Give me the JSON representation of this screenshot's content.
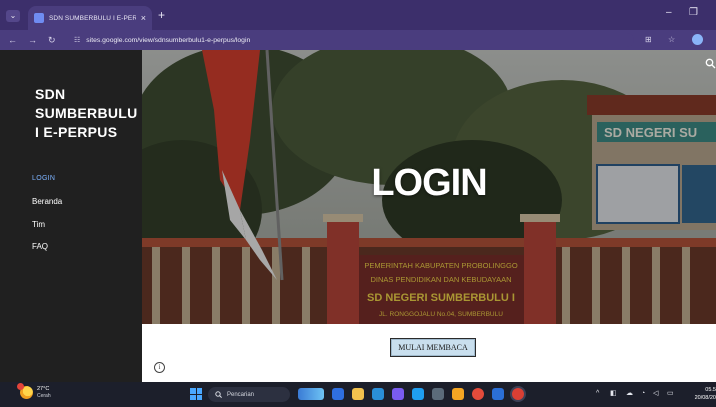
{
  "browser": {
    "tab_title": "SDN SUMBERBULU I E-PERPUS",
    "tab_close": "×",
    "new_tab": "+",
    "url": "sites.google.com/view/sdnsumberbulu1-e-perpus/login",
    "icons": [
      "tab-menu-icon",
      "back-icon",
      "forward-icon",
      "reload-icon",
      "site-settings-icon",
      "translate-icon",
      "bookmark-star-icon",
      "profile-icon",
      "minimize-icon",
      "restore-icon"
    ]
  },
  "sidebar": {
    "site_name": "SDN SUMBERBULU I E-PERPUS",
    "items": [
      {
        "label": "LOGIN",
        "active": true
      },
      {
        "label": "Beranda",
        "active": false
      },
      {
        "label": "Tim",
        "active": false
      },
      {
        "label": "FAQ",
        "active": false
      }
    ]
  },
  "hero": {
    "title": "LOGIN",
    "sign_text": [
      "PEMERINTAH KABUPATEN PROBOLINGGO",
      "DINAS PENDIDIKAN DAN KEBUDAYAAN",
      "SD NEGERI SUMBERBULU I",
      "JL. RONGGOJALU No.04, SUMBERBULU"
    ],
    "school_banner": "SD NEGERI SU"
  },
  "content": {
    "read_button": "MULAI MEMBACA",
    "info": "i"
  },
  "taskbar": {
    "weather_temp": "27°C",
    "weather_cond": "Cerah",
    "search_placeholder": "Pencarian",
    "clock_time": "05.5",
    "clock_date": "20/08/20"
  },
  "colors": {
    "tabbar": "#3c2f6b",
    "sidebar": "#202020",
    "active_link": "#7db3ff",
    "button": "#c9dfee",
    "taskbar": "#1c1f2b"
  }
}
